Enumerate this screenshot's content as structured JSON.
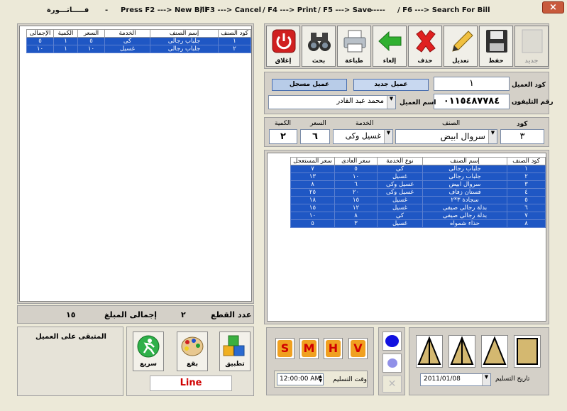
{
  "title_bar": {
    "app_title": "فـــــاتـــورة",
    "dash": "-",
    "hotkeys": [
      "Press F2 ---> New Bill",
      "/ F3 ---> Cancel",
      "/ F4 ---> Print",
      "/ F5 ---> Save",
      "-----",
      "/ F6 ---> Search For Bill"
    ],
    "close": "×"
  },
  "toolbar": {
    "new": "جديد",
    "save": "حفظ",
    "edit": "تعديل",
    "delete": "حذف",
    "cancel": "إلغاء",
    "print": "طباعة",
    "search": "بحث",
    "close": "إغلاق"
  },
  "customer": {
    "code_label": "كود العميل",
    "code_value": "١",
    "phone_label": "رقم التليفون",
    "phone_value": "٠١١٥٤٨٧٧٨٤",
    "name_label": "اسم العميل",
    "name_value": "محمد عبد القادر",
    "new_btn": "عميل جديد",
    "registered_btn": "عميل مسجل"
  },
  "item_entry": {
    "code_label": "كود",
    "code_value": "٣",
    "item_label": "الصنف",
    "item_value": "سروال ابيض",
    "service_label": "الخدمة",
    "service_value": "غسيل وكى",
    "price_label": "السعر",
    "price_value": "٦",
    "qty_label": "الكمية",
    "qty_value": "٢"
  },
  "price_list": {
    "headers": [
      "كود الصنف",
      "إسم الصنف",
      "نوع الخدمة",
      "سعر العادى",
      "سعر المستعجل"
    ],
    "rows": [
      [
        "١",
        "جلباب رجالى",
        "كى",
        "٥",
        "٧"
      ],
      [
        "٢",
        "جلباب رجالى",
        "غسيل",
        "١٠",
        "١٣"
      ],
      [
        "٣",
        "سروال ابيض",
        "غسيل وكى",
        "٦",
        "٨"
      ],
      [
        "٤",
        "فستان زفاف",
        "غسيل وكى",
        "٢٠",
        "٢٥"
      ],
      [
        "٥",
        "سجادة ٣*٢",
        "غسيل",
        "١٥",
        "١٨"
      ],
      [
        "٦",
        "بدلة رجالى صيفى",
        "غسيل",
        "١٢",
        "١٥"
      ],
      [
        "٧",
        "بدلة رجالى صيفى",
        "كى",
        "٨",
        "١٠"
      ],
      [
        "٨",
        "حذاء شمواه",
        "غسيل",
        "٣",
        "٥"
      ]
    ]
  },
  "bill": {
    "headers": [
      "كود الصنف",
      "إسم الصنف",
      "الخدمة",
      "السعر",
      "الكمية",
      "الإجمالى"
    ],
    "rows": [
      [
        "١",
        "جلباب رجالى",
        "كى",
        "٥",
        "١",
        "٥"
      ],
      [
        "٢",
        "جلباب رجالى",
        "غسيل",
        "١٠",
        "١",
        "١٠"
      ]
    ]
  },
  "totals": {
    "pieces_label": "عدد القطع",
    "pieces_value": "٢",
    "amount_label": "إجمالى المبلغ",
    "amount_value": "١٥"
  },
  "remaining_label": "المتبقى على العميل",
  "service_buttons": {
    "apply": "تطبيق",
    "stain": "بقع",
    "fast": "سريع",
    "line": "Line"
  },
  "sizes": [
    "S",
    "M",
    "H",
    "V"
  ],
  "delivery": {
    "time_label": "وقت التسليم",
    "time_value": "12:00:00 AM",
    "date_label": "تاريخ التسليم",
    "date_value": "2011/01/08"
  },
  "colors": {
    "grid_row": "#1f57c4",
    "close_red": "#c85a3c",
    "size_letter": "#d00000",
    "line_text": "#d00000"
  }
}
